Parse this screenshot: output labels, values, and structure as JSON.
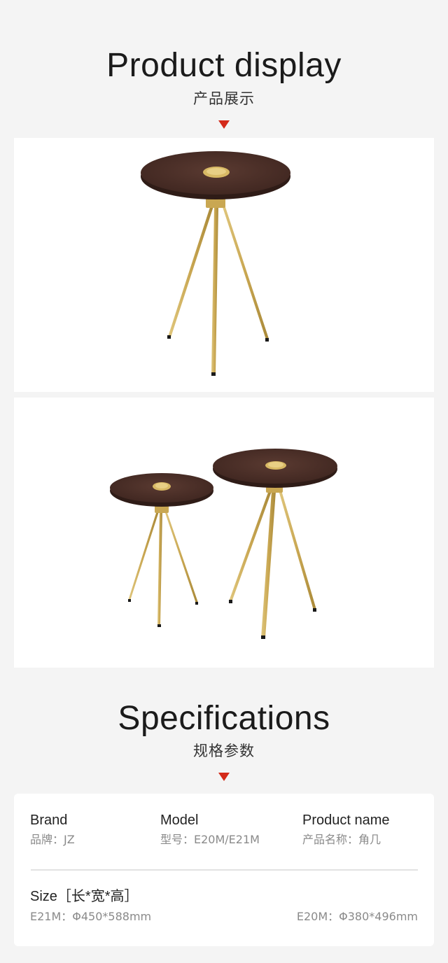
{
  "display": {
    "title": "Product display",
    "subtitle": "产品展示"
  },
  "specs": {
    "title": "Specifications",
    "subtitle": "规格参数",
    "brand": {
      "label": "Brand",
      "value": "品牌：JZ"
    },
    "model": {
      "label": "Model",
      "value": "型号：E20M/E21M"
    },
    "product_name": {
      "label": "Product name",
      "value": "产品名称：角几"
    },
    "size": {
      "label": "Size［长*宽*高］",
      "e21m": "E21M：Φ450*588mm",
      "e20m": "E20M：Φ380*496mm"
    }
  },
  "colors": {
    "background": "#f4f4f4",
    "panel": "#ffffff",
    "accent_marker": "#d42a1a",
    "wood": "#4a2e27",
    "brass": "#c9a752"
  }
}
